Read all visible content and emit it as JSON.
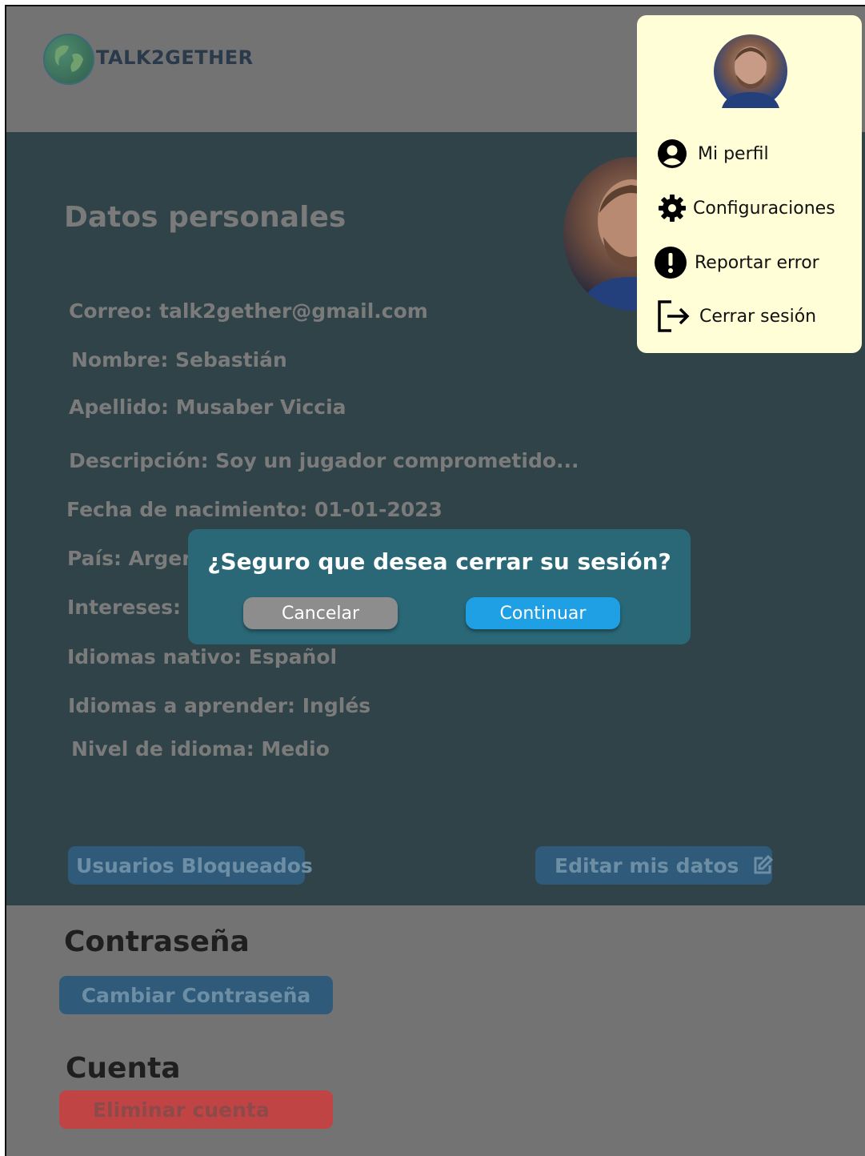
{
  "app": {
    "logo_text": "TALK2GETHER"
  },
  "profile": {
    "section_title": "Datos personales",
    "fields": {
      "correo": "Correo: talk2gether@gmail.com",
      "nombre": "Nombre: Sebastián",
      "apellido": "Apellido: Musaber Viccia",
      "descripcion": "Descripción: Soy un jugador comprometido...",
      "fecha": "Fecha de nacimiento: 01-01-2023",
      "pais": "País: Argen",
      "intereses": "Intereses: C",
      "idioma_nativo": "Idiomas nativo: Español",
      "idioma_aprender": "Idiomas a aprender: Inglés",
      "nivel": "Nivel de idioma: Medio"
    },
    "blocked_users_label": "Usuarios Bloqueados",
    "edit_label": "Editar mis datos"
  },
  "password": {
    "title": "Contraseña",
    "change_label": "Cambiar Contraseña"
  },
  "account": {
    "title": "Cuenta",
    "delete_label": "Eliminar cuenta"
  },
  "menu": {
    "items": [
      {
        "label": "Mi perfil",
        "icon": "user-circle-icon"
      },
      {
        "label": "Configuraciones",
        "icon": "gear-icon"
      },
      {
        "label": "Reportar error",
        "icon": "exclamation-icon"
      },
      {
        "label": "Cerrar sesión",
        "icon": "logout-icon"
      }
    ]
  },
  "modal": {
    "title": "¿Seguro que desea cerrar su sesión?",
    "cancel_label": "Cancelar",
    "continue_label": "Continuar"
  },
  "colors": {
    "menu_bg": "#fffed7",
    "modal_bg": "#2a6877",
    "continue_btn": "#1f9fe4",
    "cancel_btn": "#8d8d8d",
    "overlay_main": "#2f4348",
    "overlay_gray": "#737373"
  }
}
